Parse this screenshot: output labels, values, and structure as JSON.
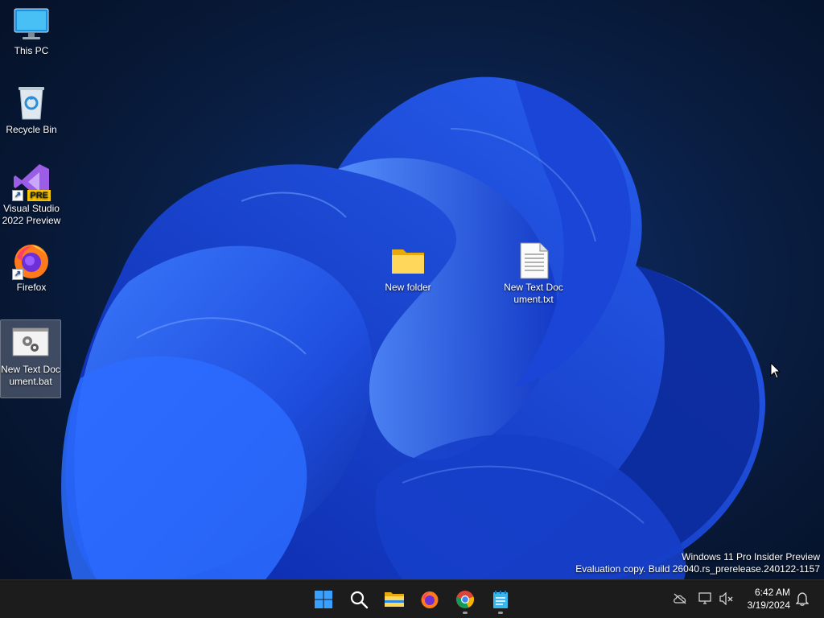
{
  "desktop": {
    "icons": [
      {
        "label": "This PC"
      },
      {
        "label": "Recycle Bin"
      },
      {
        "label": "Visual Studio 2022 Preview",
        "badge": "PRE"
      },
      {
        "label": "Firefox"
      },
      {
        "label": "New Text Document.bat"
      },
      {
        "label": "New folder"
      },
      {
        "label": "New Text Document.txt"
      }
    ],
    "watermark": {
      "line1": "Windows 11 Pro Insider Preview",
      "line2": "Evaluation copy. Build 26040.rs_prerelease.240122-1157"
    }
  },
  "taskbar": {
    "pinned": [
      "windows-start-icon",
      "search-icon",
      "file-explorer-icon",
      "firefox-icon",
      "chrome-icon",
      "notepad-icon"
    ],
    "tray": [
      "onedrive-offline-icon",
      "network-icon",
      "volume-muted-icon",
      "notification-bell-icon"
    ],
    "clock": {
      "time": "6:42 AM",
      "date": "3/19/2024"
    }
  },
  "colors": {
    "taskbar": "#1c1c1c",
    "accent": "#2f6fff",
    "folder": "#f4c542"
  }
}
